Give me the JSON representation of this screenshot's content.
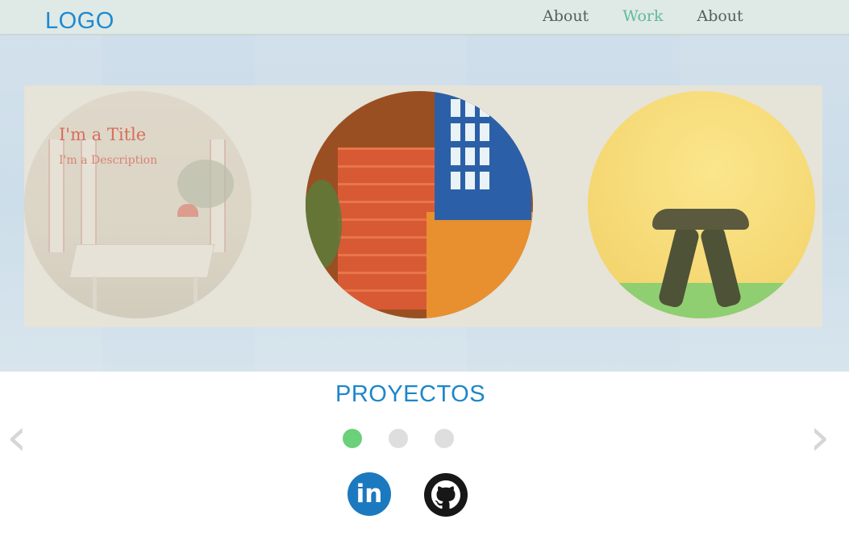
{
  "header": {
    "logo": "LOGO",
    "nav": [
      {
        "label": "About",
        "active": false
      },
      {
        "label": "Work",
        "active": true
      },
      {
        "label": "About",
        "active": false
      }
    ]
  },
  "gallery": {
    "items": [
      {
        "title": "I'm a Title",
        "description": "I'm a Description",
        "image": "dining-room"
      },
      {
        "image": "red-stairs"
      },
      {
        "image": "green-stool"
      }
    ]
  },
  "section": {
    "title": "PROYECTOS",
    "prev_icon": "chevron-left-icon",
    "next_icon": "chevron-right-icon",
    "pagination": {
      "count": 3,
      "active": 1
    }
  },
  "social": {
    "linkedin_text": "in",
    "linkedin_icon": "linkedin-icon",
    "github_icon": "github-icon"
  },
  "colors": {
    "accent": "#1d86c9",
    "nav_active": "#5dbb9c",
    "dot_active": "#6ad07a",
    "linkedin": "#1b79c0"
  }
}
